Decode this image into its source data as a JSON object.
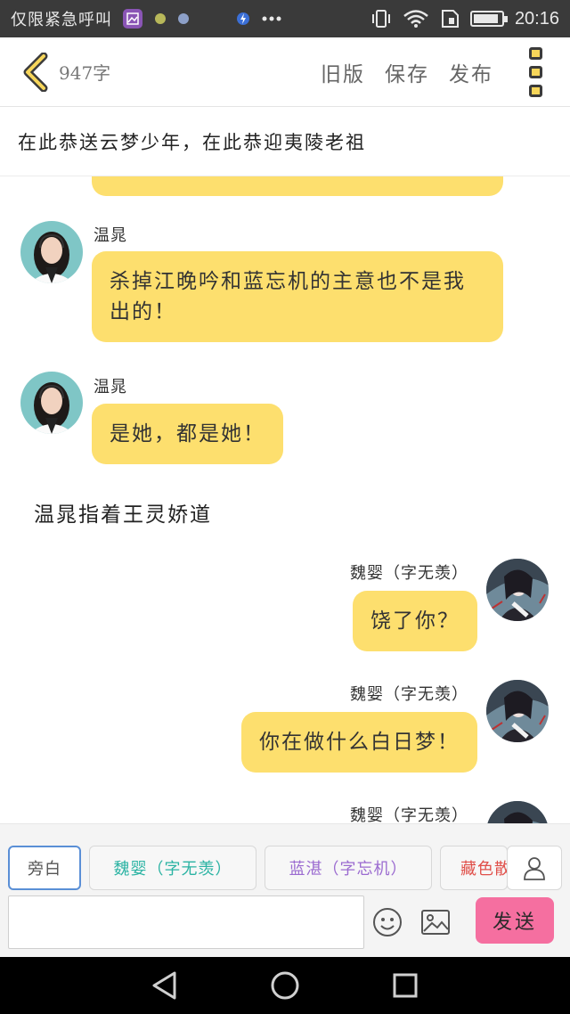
{
  "status_bar": {
    "carrier": "仅限紧急呼叫",
    "time": "20:16",
    "battery_level": 0.9,
    "icons": [
      "gallery-icon",
      "notification-dot-icon",
      "settings-dot-icon",
      "flash-icon",
      "more-icon",
      "vibrate-icon",
      "wifi-icon",
      "sim-icon",
      "battery-icon"
    ]
  },
  "toolbar": {
    "word_count": "947字",
    "old_version": "旧版",
    "save": "保存",
    "publish": "发布"
  },
  "story": {
    "title": "在此恭送云梦少年，在此恭迎夷陵老祖"
  },
  "messages": [
    {
      "speaker": "温晁",
      "text": "杀掉江晚吟和蓝忘机的主意也不是我出的！"
    },
    {
      "speaker": "温晁",
      "text": "是她，都是她！"
    },
    {
      "narration": "温晁指着王灵娇道"
    },
    {
      "speaker": "魏婴（字无羡）",
      "text": "饶了你？"
    },
    {
      "speaker": "魏婴（字无羡）",
      "text": "你在做什么白日梦！"
    },
    {
      "speaker": "魏婴（字无羡）",
      "text": ""
    }
  ],
  "characters": [
    {
      "label": "旁白",
      "color": "#555555"
    },
    {
      "label": "魏婴（字无羡）",
      "color": "#2bb3a3"
    },
    {
      "label": "蓝湛（字忘机）",
      "color": "#9b6bd0"
    },
    {
      "label": "藏色散人",
      "color": "#e0504a"
    }
  ],
  "composer": {
    "placeholder": "",
    "send_label": "发送"
  },
  "colors": {
    "bubble": "#fddf6e",
    "send_button": "#f56fa0",
    "accent_border": "#5a8fd6"
  }
}
